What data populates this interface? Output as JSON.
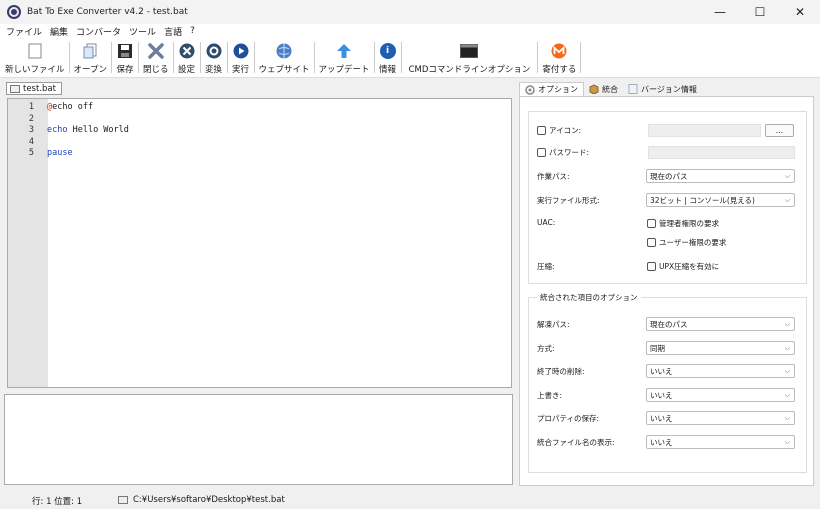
{
  "window": {
    "title": "Bat To Exe Converter v4.2 - test.bat",
    "minimize": "—",
    "maximize": "☐",
    "close": "✕"
  },
  "menu": [
    "ファイル",
    "編集",
    "コンバータ",
    "ツール",
    "言語",
    "?"
  ],
  "toolbar": [
    {
      "label": "新しいファイル",
      "icon": "new-file-icon"
    },
    {
      "label": "オープン",
      "icon": "open-icon"
    },
    {
      "label": "保存",
      "icon": "save-icon"
    },
    {
      "label": "閉じる",
      "icon": "close-file-icon"
    },
    {
      "label": "設定",
      "icon": "settings-icon"
    },
    {
      "label": "変換",
      "icon": "convert-icon"
    },
    {
      "label": "実行",
      "icon": "run-icon"
    },
    {
      "label": "ウェブサイト",
      "icon": "website-icon"
    },
    {
      "label": "アップデート",
      "icon": "update-icon"
    },
    {
      "label": "情報",
      "icon": "info-icon"
    },
    {
      "label": "CMDコマンドラインオプション",
      "icon": "cmd-icon"
    },
    {
      "label": "寄付する",
      "icon": "donate-icon"
    }
  ],
  "file_tab": "test.bat",
  "editor": {
    "lines": [
      {
        "n": "1",
        "prefix": "@",
        "keyword": "",
        "rest": "echo off"
      },
      {
        "n": "2",
        "prefix": "",
        "keyword": "",
        "rest": ""
      },
      {
        "n": "3",
        "prefix": "",
        "keyword": "echo",
        "rest": " Hello World"
      },
      {
        "n": "4",
        "prefix": "",
        "keyword": "",
        "rest": ""
      },
      {
        "n": "5",
        "prefix": "",
        "keyword": "pause",
        "rest": ""
      }
    ]
  },
  "right_tabs": [
    "オプション",
    "統合",
    "バージョン情報"
  ],
  "options": {
    "icon_label": "アイコン:",
    "browse": "...",
    "password_label": "パスワード:",
    "workdir_label": "作業パス:",
    "workdir_value": "現在のパス",
    "exe_format_label": "実行ファイル形式:",
    "exe_format_value": "32ビット | コンソール(見える)",
    "uac_label": "UAC:",
    "uac_admin": "管理者権限の要求",
    "uac_user": "ユーザー権限の要求",
    "compress_label": "圧縮:",
    "upx": "UPX圧縮を有効に"
  },
  "integrated": {
    "title": "統合された項目のオプション",
    "rows": [
      {
        "label": "解凍パス:",
        "value": "現在のパス"
      },
      {
        "label": "方式:",
        "value": "同期"
      },
      {
        "label": "終了時の削除:",
        "value": "いいえ"
      },
      {
        "label": "上書き:",
        "value": "いいえ"
      },
      {
        "label": "プロパティの保存:",
        "value": "いいえ"
      },
      {
        "label": "統合ファイル名の表示:",
        "value": "いいえ"
      }
    ]
  },
  "status": {
    "position": "行: 1  位置: 1",
    "path": "C:¥Users¥softaro¥Desktop¥test.bat"
  }
}
